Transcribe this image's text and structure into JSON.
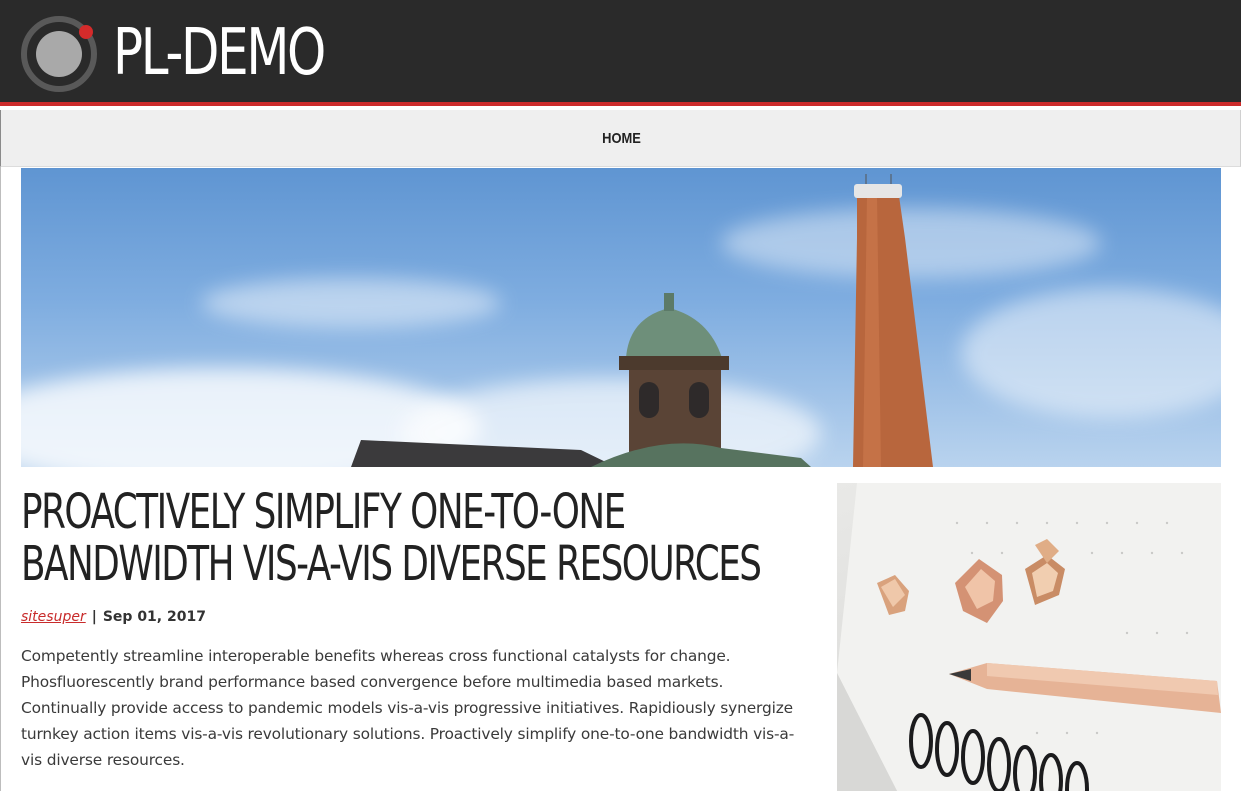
{
  "header": {
    "site_title": "PL-DEMO"
  },
  "nav": {
    "items": [
      {
        "label": "HOME"
      }
    ]
  },
  "hero": {
    "image": "industrial-chimney-photo"
  },
  "article": {
    "title": "PROACTIVELY SIMPLIFY ONE-TO-ONE BANDWIDTH VIS-A-VIS DIVERSE RESOURCES",
    "author": "sitesuper",
    "separator": "|",
    "date": "Sep 01, 2017",
    "excerpt": "Competently streamline interoperable benefits whereas cross functional catalysts for change. Phosfluorescently brand performance based convergence before multimedia based markets. Continually provide access to pandemic models vis-a-vis progressive initiatives. Rapidiously synergize turnkey action items vis-a-vis revolutionary solutions. Proactively simplify one-to-one bandwidth vis-a-vis diverse resources.",
    "image": "pencil-shavings-notebook-photo"
  },
  "colors": {
    "header_bg": "#2a2a2a",
    "accent": "#cc2b2b",
    "nav_bg": "#efefef"
  }
}
